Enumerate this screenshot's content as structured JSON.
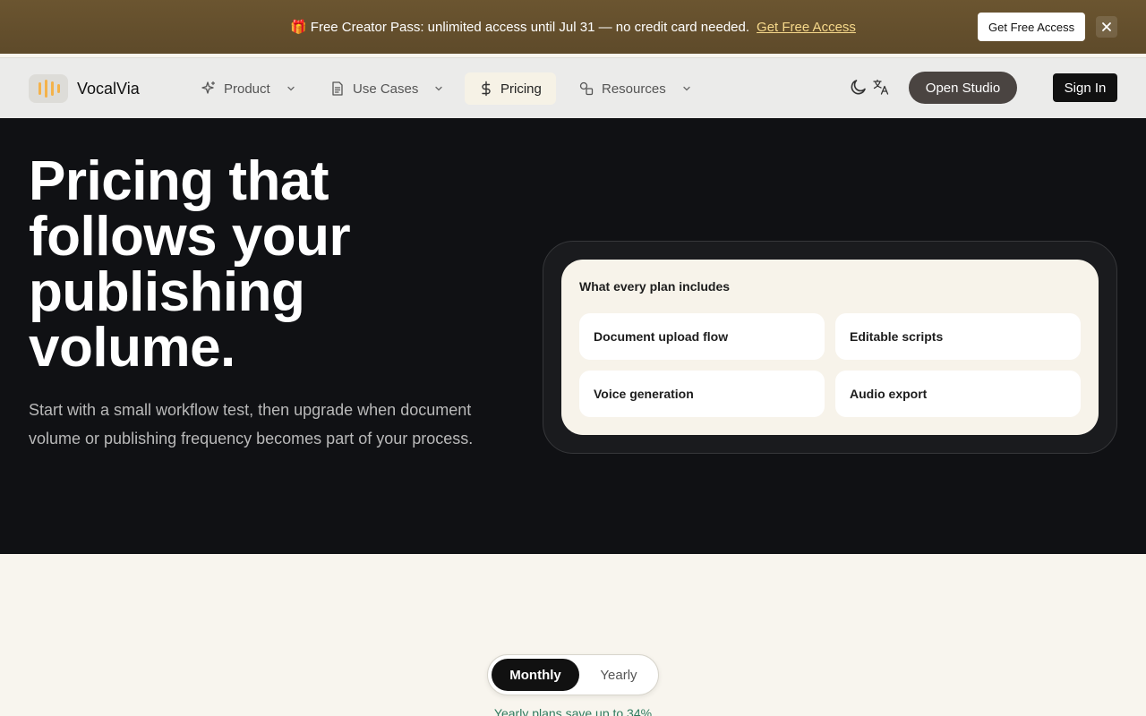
{
  "banner": {
    "emoji": "🎁",
    "text": "Free Creator Pass: unlimited access until Jul 31 — no credit card needed.",
    "link_label": "Get Free Access",
    "button_label": "Get Free Access"
  },
  "nav": {
    "brand": "VocalVia",
    "items": [
      {
        "label": "Product"
      },
      {
        "label": "Use Cases"
      },
      {
        "label": "Pricing"
      },
      {
        "label": "Resources"
      }
    ],
    "open_studio_label": "Open Studio",
    "sign_in_label": "Sign In"
  },
  "hero": {
    "title": "Pricing that follows your publishing volume.",
    "subtitle": "Start with a small workflow test, then upgrade when document volume or publishing frequency becomes part of your process."
  },
  "includes": {
    "title": "What every plan includes",
    "features": [
      "Document upload flow",
      "Editable scripts",
      "Voice generation",
      "Audio export"
    ]
  },
  "billing": {
    "options": [
      "Monthly",
      "Yearly"
    ],
    "selected": "Monthly",
    "savings_note": "Yearly plans save up to 34%"
  },
  "colors": {
    "banner_bg": "#5e4a2a",
    "banner_link": "#f7d98b",
    "hero_bg": "#101114",
    "accent_green": "#2f7a5e",
    "page_bg": "#f8f5ee"
  }
}
